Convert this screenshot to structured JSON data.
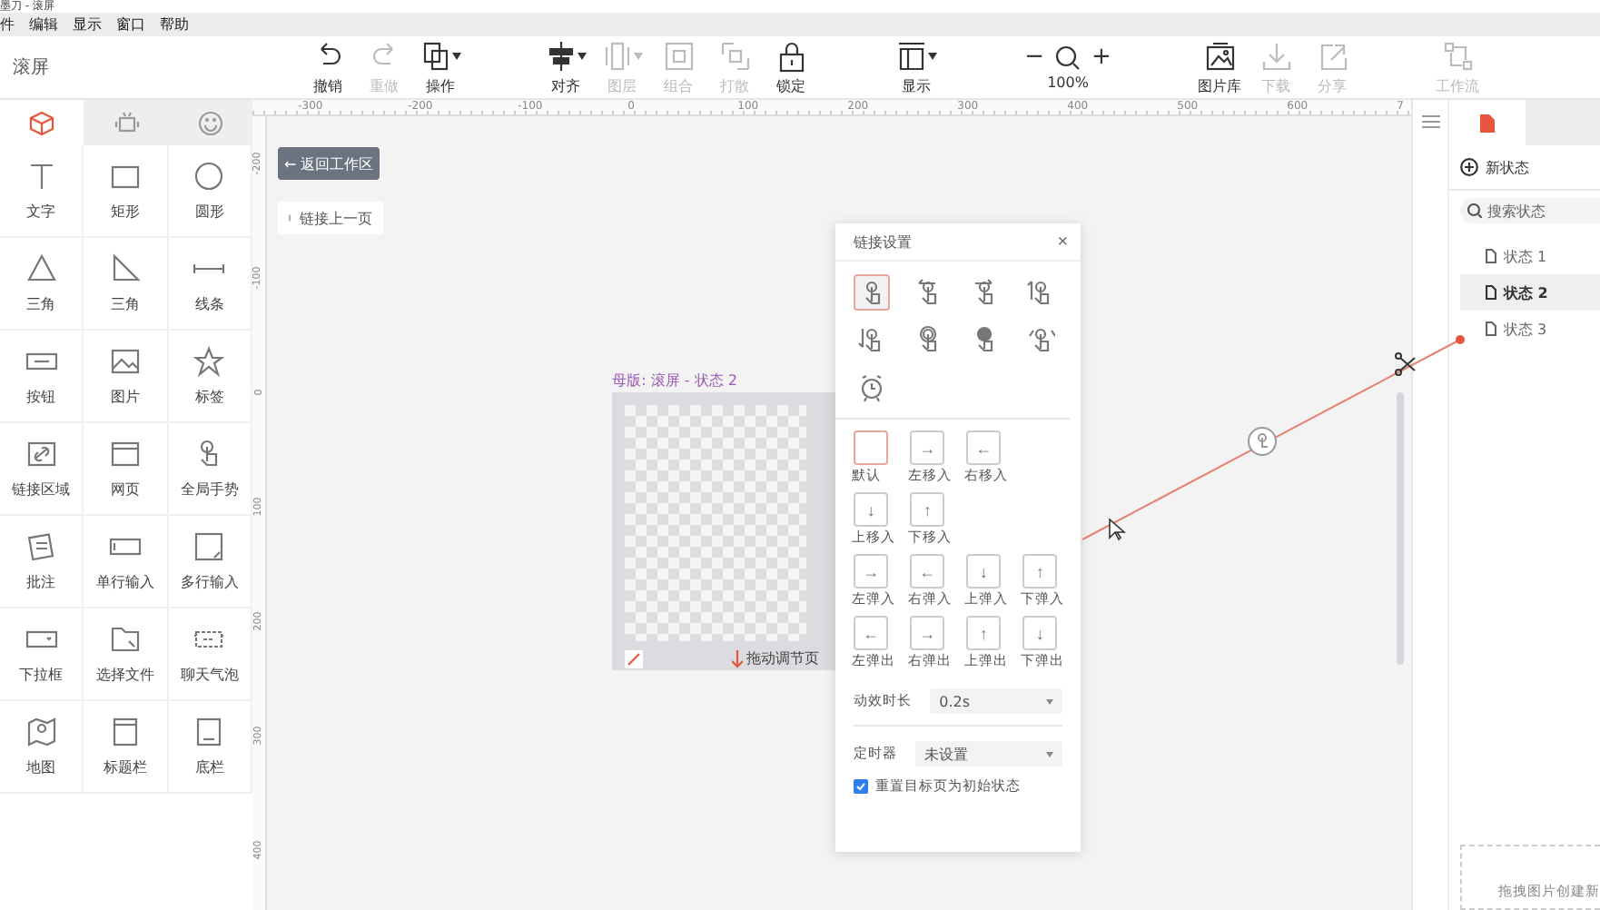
{
  "window": {
    "title": "墨刀 - 滚屏"
  },
  "menu": [
    "件",
    "编辑",
    "显示",
    "窗口",
    "帮助"
  ],
  "toolbar": {
    "page_name": "滚屏",
    "groups": [
      [
        {
          "label": "撤销",
          "disabled": false,
          "dropdown": false
        },
        {
          "label": "重做",
          "disabled": true,
          "dropdown": false
        },
        {
          "label": "操作",
          "disabled": false,
          "dropdown": true
        }
      ],
      [
        {
          "label": "对齐",
          "disabled": false,
          "dropdown": true
        },
        {
          "label": "图层",
          "disabled": true,
          "dropdown": true
        },
        {
          "label": "组合",
          "disabled": true,
          "dropdown": false
        },
        {
          "label": "打散",
          "disabled": true,
          "dropdown": false
        },
        {
          "label": "锁定",
          "disabled": false,
          "dropdown": false
        }
      ],
      [
        {
          "label": "显示",
          "disabled": false,
          "dropdown": true
        }
      ],
      [
        {
          "label": "图片库",
          "disabled": false,
          "dropdown": false
        },
        {
          "label": "下载",
          "disabled": true,
          "dropdown": false
        },
        {
          "label": "分享",
          "disabled": true,
          "dropdown": false
        }
      ],
      [
        {
          "label": "工作流",
          "disabled": true,
          "dropdown": false
        }
      ]
    ],
    "zoom": {
      "minus": "−",
      "plus": "+",
      "value": "100%"
    }
  },
  "left_tabs": [
    {
      "selected": true
    },
    {
      "selected": false
    },
    {
      "selected": false
    }
  ],
  "components": [
    "文字",
    "矩形",
    "圆形",
    "三角",
    "三角",
    "线条",
    "按钮",
    "图片",
    "标签",
    "链接区域",
    "网页",
    "全局手势",
    "批注",
    "单行输入",
    "多行输入",
    "下拉框",
    "选择文件",
    "聊天气泡",
    "地图",
    "标题栏",
    "底栏"
  ],
  "ruler": {
    "horizontal": [
      "-300",
      "-200",
      "-100",
      "0",
      "100",
      "200",
      "300",
      "400",
      "500",
      "600",
      "7"
    ],
    "vertical": [
      "-200",
      "-100",
      "0",
      "100",
      "200",
      "300",
      "400"
    ]
  },
  "canvas": {
    "back_button": "← 返回工作区",
    "link_prev": "链接上一页",
    "master_label": "母版: 滚屏 - 状态 2",
    "drag_hint": "拖动调节页"
  },
  "link_dialog": {
    "title": "链接设置",
    "close": "×",
    "gestures": [
      {
        "selected": true
      },
      {
        "selected": false
      },
      {
        "selected": false
      },
      {
        "selected": false
      },
      {
        "selected": false
      },
      {
        "selected": false
      },
      {
        "selected": false
      },
      {
        "selected": false
      },
      {
        "selected": false
      }
    ],
    "animations": [
      {
        "label": "默认",
        "selected": true
      },
      {
        "label": "左移入",
        "arrow": "→",
        "selected": false
      },
      {
        "label": "右移入",
        "arrow": "←",
        "selected": false
      },
      {
        "label": "上移入",
        "arrow": "↓",
        "selected": false
      },
      {
        "label": "下移入",
        "arrow": "↑",
        "selected": false
      },
      {
        "label": "左弹入",
        "arrow": "→",
        "selected": false
      },
      {
        "label": "右弹入",
        "arrow": "←",
        "selected": false
      },
      {
        "label": "上弹入",
        "arrow": "↓",
        "selected": false
      },
      {
        "label": "下弹入",
        "arrow": "↑",
        "selected": false
      },
      {
        "label": "左弹出",
        "arrow": "←",
        "selected": false
      },
      {
        "label": "右弹出",
        "arrow": "→",
        "selected": false
      },
      {
        "label": "上弹出",
        "arrow": "↑",
        "selected": false
      },
      {
        "label": "下弹出",
        "arrow": "↓",
        "selected": false
      }
    ],
    "duration": {
      "label": "动效时长",
      "value": "0.2s"
    },
    "timer": {
      "label": "定时器",
      "value": "未设置"
    },
    "reset": {
      "label": "重置目标页为初始状态",
      "checked": true
    }
  },
  "right_tabs": [
    {
      "selected": true
    },
    {
      "selected": false
    }
  ],
  "states_panel": {
    "new_state": "新状态",
    "search_placeholder": "搜索状态",
    "states": [
      {
        "label": "状态 1",
        "selected": false
      },
      {
        "label": "状态 2",
        "selected": true
      },
      {
        "label": "状态 3",
        "selected": false
      }
    ],
    "drop_hint": "拖拽图片创建新"
  }
}
